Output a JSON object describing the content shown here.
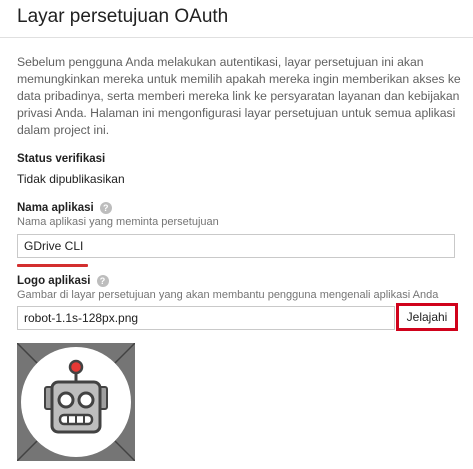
{
  "page": {
    "title": "Layar persetujuan OAuth",
    "description": "Sebelum pengguna Anda melakukan autentikasi, layar persetujuan ini akan memungkinkan mereka untuk memilih apakah mereka ingin memberikan akses ke data pribadinya, serta memberi mereka link ke persyaratan layanan dan kebijakan privasi Anda. Halaman ini mengonfigurasi layar persetujuan untuk semua aplikasi dalam project ini."
  },
  "verification": {
    "label": "Status verifikasi",
    "value": "Tidak dipublikasikan"
  },
  "app_name": {
    "label": "Nama aplikasi",
    "help_icon": "?",
    "hint": "Nama aplikasi yang meminta persetujuan",
    "value": "GDrive CLI"
  },
  "app_logo": {
    "label": "Logo aplikasi",
    "help_icon": "?",
    "hint": "Gambar di layar persetujuan yang akan membantu pengguna mengenali aplikasi Anda",
    "file_name": "robot-1.1s-128px.png",
    "browse_label": "Jelajahi",
    "image_icon": "robot-icon"
  },
  "colors": {
    "highlight": "#d0021b",
    "underline": "#d32f2f"
  }
}
